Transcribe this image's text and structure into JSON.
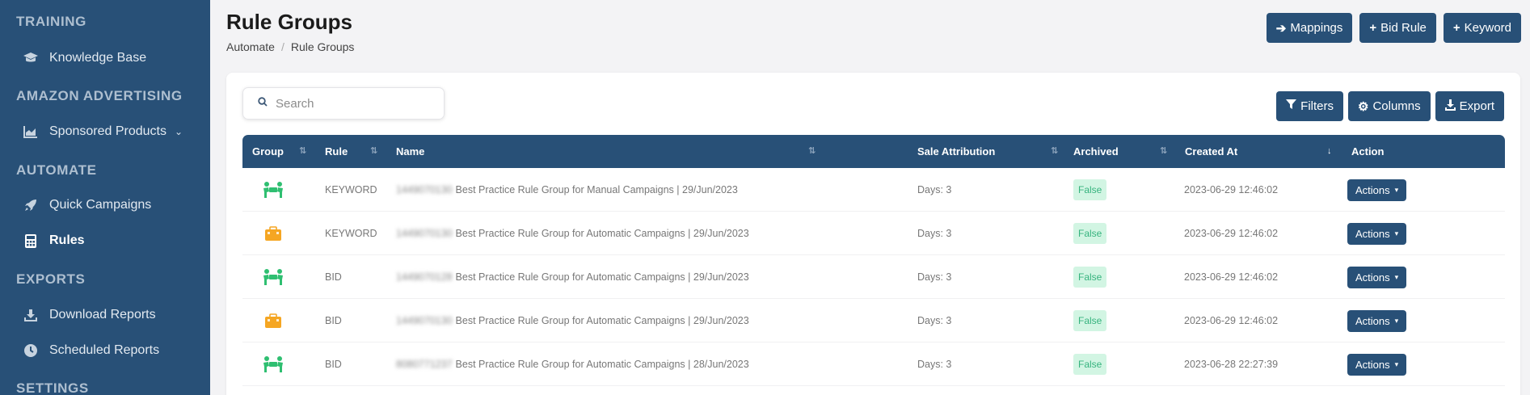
{
  "sidebar": {
    "sections": [
      {
        "title": "TRAINING"
      },
      {
        "title": "AMAZON ADVERTISING"
      },
      {
        "title": "AUTOMATE"
      },
      {
        "title": "EXPORTS"
      },
      {
        "title": "SETTINGS"
      }
    ],
    "items": [
      {
        "label": "Knowledge Base",
        "icon": "graduation-cap-icon"
      },
      {
        "label": "Sponsored Products",
        "icon": "area-chart-icon",
        "expandable": true
      },
      {
        "label": "Quick Campaigns",
        "icon": "rocket-icon"
      },
      {
        "label": "Rules",
        "icon": "calculator-icon",
        "active": true
      },
      {
        "label": "Download Reports",
        "icon": "download-icon"
      },
      {
        "label": "Scheduled Reports",
        "icon": "clock-icon"
      }
    ]
  },
  "header": {
    "title": "Rule Groups",
    "breadcrumb": [
      "Automate",
      "Rule Groups"
    ],
    "buttons": [
      {
        "label": "Mappings",
        "icon": "arrow-right-icon"
      },
      {
        "label": "Bid Rule",
        "icon": "plus-icon"
      },
      {
        "label": "Keyword",
        "icon": "plus-icon"
      }
    ]
  },
  "toolbar": {
    "search_placeholder": "Search",
    "buttons": [
      {
        "label": "Filters",
        "icon": "filter-icon"
      },
      {
        "label": "Columns",
        "icon": "gear-icon"
      },
      {
        "label": "Export",
        "icon": "export-icon"
      }
    ]
  },
  "table": {
    "columns": [
      "Group",
      "Rule",
      "Name",
      "Sale Attribution",
      "Archived",
      "Created At",
      "Action"
    ],
    "rows": [
      {
        "group_icon": "people-carry-icon",
        "rule": "KEYWORD",
        "name_prefix": "1449070130",
        "name": "Best Practice Rule Group for Manual Campaigns | 29/Jun/2023",
        "attribution": "Days: 3",
        "archived": "False",
        "created": "2023-06-29 12:46:02",
        "action": "Actions"
      },
      {
        "group_icon": "briefcase-icon",
        "rule": "KEYWORD",
        "name_prefix": "1449070130",
        "name": "Best Practice Rule Group for Automatic Campaigns | 29/Jun/2023",
        "attribution": "Days: 3",
        "archived": "False",
        "created": "2023-06-29 12:46:02",
        "action": "Actions"
      },
      {
        "group_icon": "people-carry-icon",
        "rule": "BID",
        "name_prefix": "1449070128",
        "name": "Best Practice Rule Group for Automatic Campaigns | 29/Jun/2023",
        "attribution": "Days: 3",
        "archived": "False",
        "created": "2023-06-29 12:46:02",
        "action": "Actions"
      },
      {
        "group_icon": "briefcase-icon",
        "rule": "BID",
        "name_prefix": "1449070130",
        "name": "Best Practice Rule Group for Automatic Campaigns | 29/Jun/2023",
        "attribution": "Days: 3",
        "archived": "False",
        "created": "2023-06-29 12:46:02",
        "action": "Actions"
      },
      {
        "group_icon": "people-carry-icon",
        "rule": "BID",
        "name_prefix": "8080771237",
        "name": "Best Practice Rule Group for Automatic Campaigns | 28/Jun/2023",
        "attribution": "Days: 3",
        "archived": "False",
        "created": "2023-06-28 22:27:39",
        "action": "Actions"
      }
    ]
  },
  "colors": {
    "primary": "#285077",
    "group_green": "#2fbf71",
    "group_orange": "#f5a623",
    "badge_bg": "#d2f5e3",
    "badge_text": "#36b37e"
  }
}
